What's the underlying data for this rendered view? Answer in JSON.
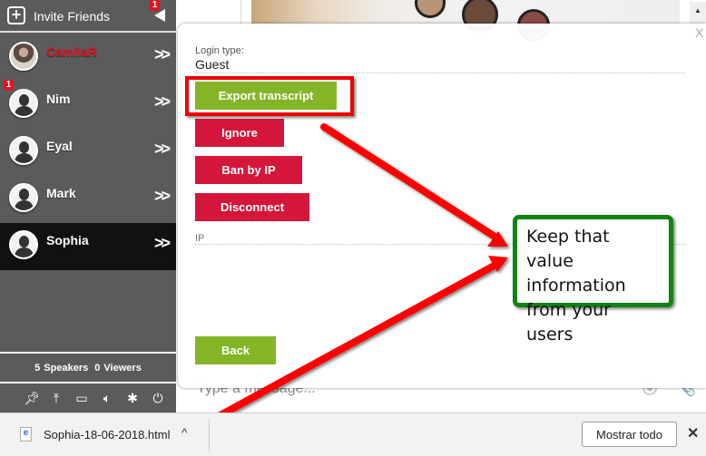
{
  "sidebar": {
    "invite_label": "Invite Friends",
    "invite_badge": "1",
    "users": [
      {
        "name": "CamilaR",
        "highlight": true,
        "badge": null,
        "active": false
      },
      {
        "name": "Nim",
        "highlight": false,
        "badge": "1",
        "active": false
      },
      {
        "name": "Eyal",
        "highlight": false,
        "badge": null,
        "active": false
      },
      {
        "name": "Mark",
        "highlight": false,
        "badge": null,
        "active": false
      },
      {
        "name": "Sophia",
        "highlight": false,
        "badge": null,
        "active": true
      }
    ],
    "speakers_count": "5",
    "speakers_label": "Speakers",
    "viewers_count": "0",
    "viewers_label": "Viewers",
    "tools": [
      "pin-icon",
      "upload-icon",
      "window-icon",
      "volume-icon",
      "settings-icon",
      "power-icon"
    ]
  },
  "chat": {
    "input_placeholder": "Type a message..."
  },
  "modal": {
    "close_label": "X",
    "login_type_label": "Login type:",
    "login_type_value": "Guest",
    "buttons": {
      "export": "Export transcript",
      "ignore": "Ignore",
      "ban": "Ban by IP",
      "disconnect": "Disconnect",
      "back": "Back"
    },
    "ip_label": "IP"
  },
  "annotation": {
    "callout_text": "Keep that value information from your users",
    "colors": {
      "box": "#ee0000",
      "callout_border": "#128312"
    }
  },
  "download_bar": {
    "file_name": "Sophia-18-06-2018.html",
    "show_all_label": "Mostrar todo",
    "close_label": "✕"
  },
  "colors": {
    "sidebar_bg": "#5b5b5b",
    "active_user_bg": "#111111",
    "green_button": "#84b527",
    "red_button": "#d4163a"
  }
}
